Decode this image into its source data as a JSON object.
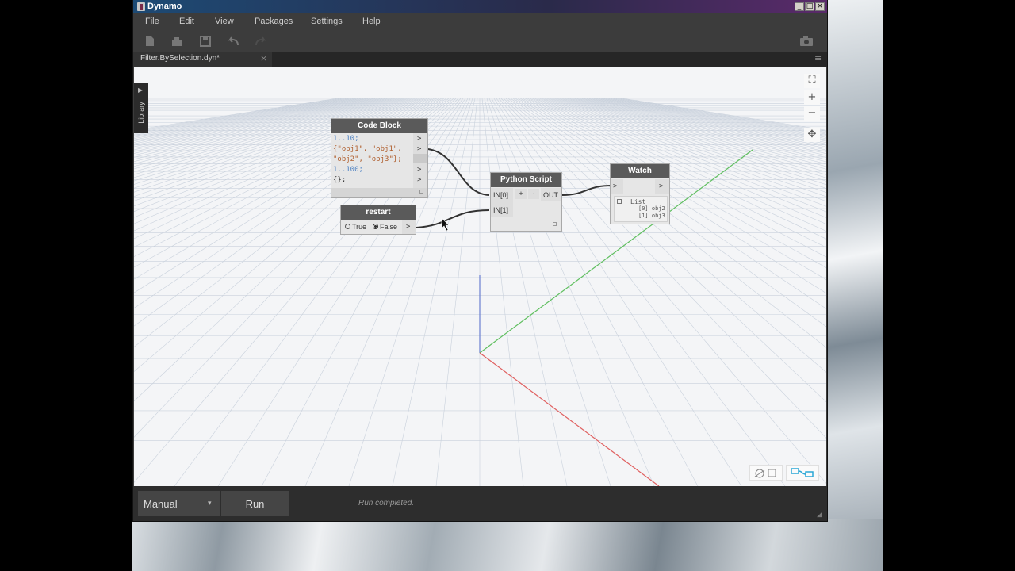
{
  "app": {
    "title": "Dynamo"
  },
  "window_controls": {
    "minimize": "_",
    "maximize": "□",
    "close": "×"
  },
  "menu": [
    "File",
    "Edit",
    "View",
    "Packages",
    "Settings",
    "Help"
  ],
  "toolbar": {
    "icons": [
      "new-file-icon",
      "open-file-icon",
      "save-icon",
      "undo-icon",
      "redo-icon"
    ],
    "screenshot_icon": "camera-icon"
  },
  "tab": {
    "label": "Filter.BySelection.dyn*",
    "close": "×",
    "menu": "≡"
  },
  "library": {
    "label": "Library",
    "arrow": "▶"
  },
  "zoom": {
    "fit": "⛶",
    "in": "+",
    "out": "−",
    "pan": "✥"
  },
  "nodes": {
    "code_block": {
      "title": "Code Block",
      "lines": [
        "1..10;",
        "{\"obj1\", \"obj1\",",
        "\"obj2\", \"obj3\"};",
        "1..100;",
        "{};"
      ],
      "ports": [
        ">",
        ">",
        ">",
        ">",
        ">"
      ]
    },
    "restart": {
      "title": "restart",
      "option_true": "True",
      "option_false": "False",
      "selected": "False",
      "port": ">"
    },
    "python": {
      "title": "Python Script",
      "in0": "IN[0]",
      "in1": "IN[1]",
      "add": "+",
      "remove": "-",
      "out": "OUT"
    },
    "watch": {
      "title": "Watch",
      "in_port": ">",
      "out_port": ">",
      "list_label": "List",
      "items": [
        "[0] obj2",
        "[1] obj3"
      ]
    }
  },
  "statusbar": {
    "run_mode": "Manual",
    "run_mode_arrow": "▾",
    "run_label": "Run",
    "status": "Run completed."
  },
  "colors": {
    "axis_x": "#e06060",
    "axis_y": "#5fbf5f",
    "axis_z": "#6a7fd0",
    "accent": "#2aa7d6"
  }
}
